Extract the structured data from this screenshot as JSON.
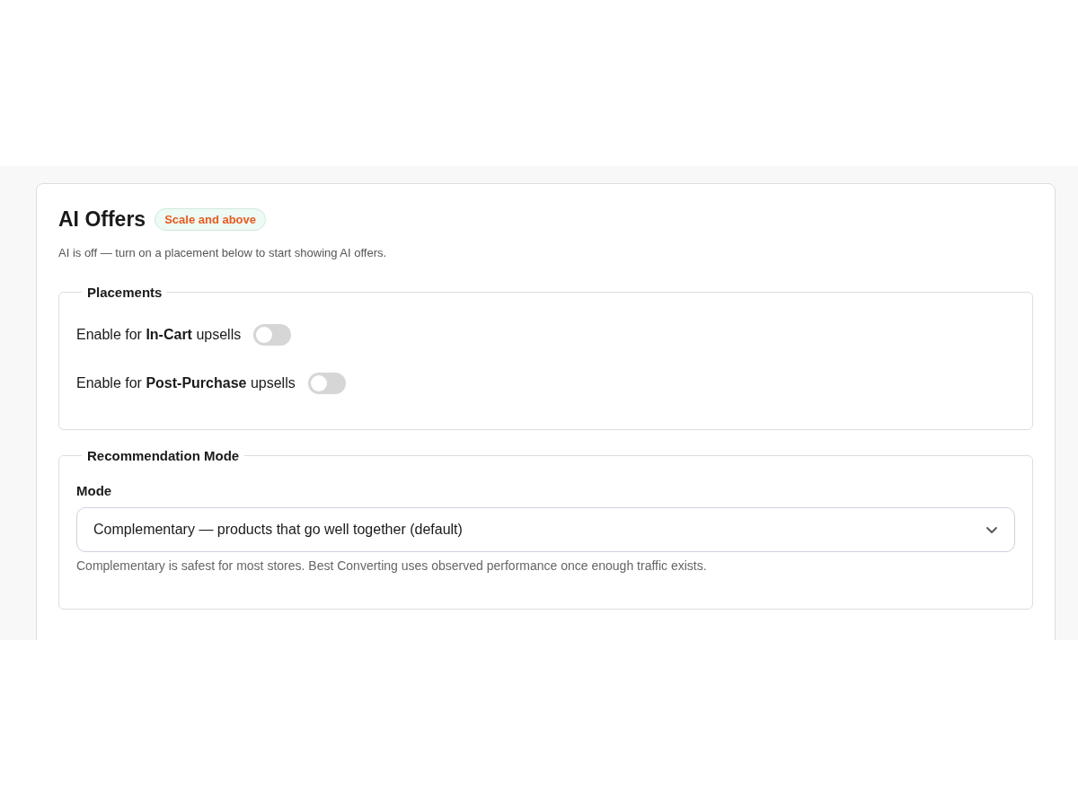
{
  "title": "AI Offers",
  "badge": "Scale and above",
  "status_text": "AI is off — turn on a placement below to start showing AI offers.",
  "placements": {
    "legend": "Placements",
    "toggles": [
      {
        "label": "Enable for **In-Cart** upsells",
        "on": false
      },
      {
        "label": "Enable for **Post-Purchase** upsells",
        "on": false
      }
    ]
  },
  "recommendation_mode": {
    "legend": "Recommendation Mode",
    "field_label": "Mode",
    "value": "Complementary — products that go well together (default)",
    "help": "Complementary is safest for most stores. Best Converting uses observed performance once enough traffic exists."
  }
}
